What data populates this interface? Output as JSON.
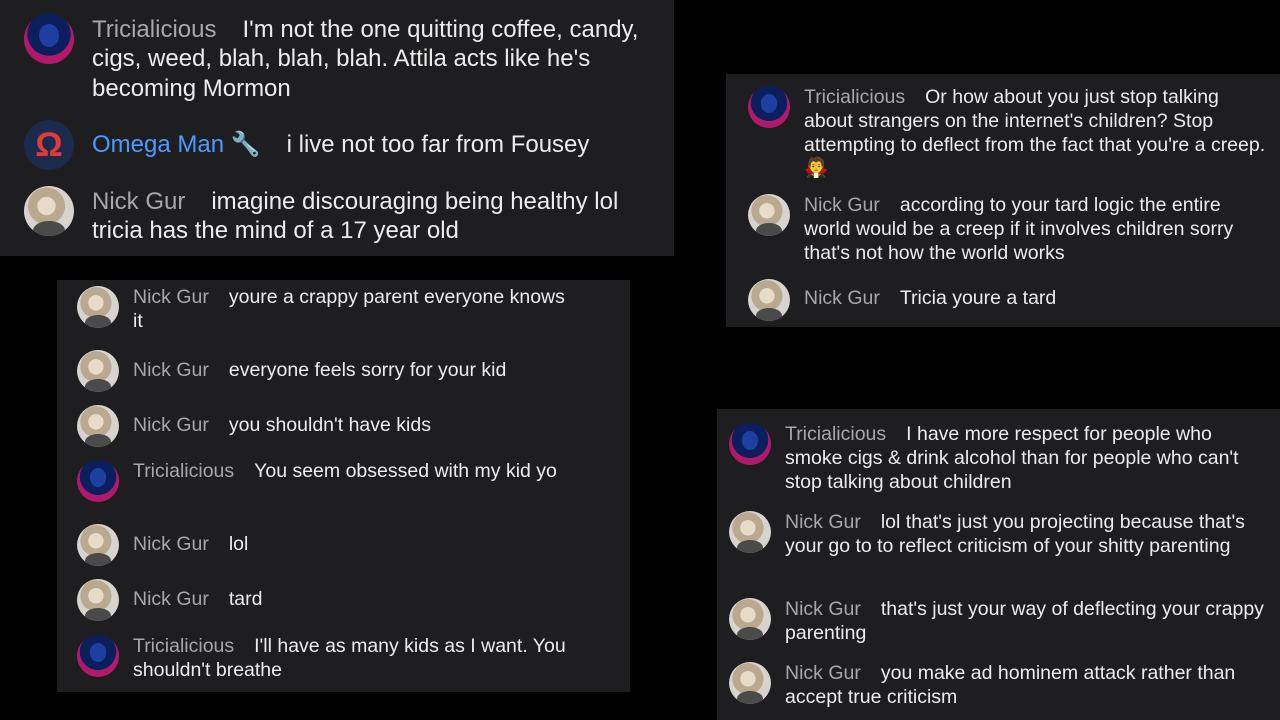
{
  "panel_a": [
    {
      "avatar": "tricia",
      "name": "Tricialicious",
      "text": "I'm not the one quitting coffee, candy, cigs, weed, blah, blah, blah. Attila acts like he's becoming Mormon"
    },
    {
      "avatar": "omega",
      "avatar_glyph": "Ω",
      "name": "Omega Man 🔧",
      "text": "i live not too far from Fousey"
    },
    {
      "avatar": "nick",
      "name": "Nick Gur",
      "text": "imagine discouraging being healthy lol tricia has the mind of a 17 year old"
    }
  ],
  "panel_b": [
    {
      "avatar": "nick",
      "name": "Nick Gur",
      "text": "youre a crappy parent everyone knows it"
    },
    {
      "avatar": "nick",
      "name": "Nick Gur",
      "text": "everyone feels sorry for your kid"
    },
    {
      "avatar": "nick",
      "name": "Nick Gur",
      "text": "you shouldn't have kids"
    },
    {
      "avatar": "tricia",
      "name": "Tricialicious",
      "text": "You seem obsessed with my kid yo"
    },
    {
      "avatar": "nick",
      "name": "Nick Gur",
      "text": "lol"
    },
    {
      "avatar": "nick",
      "name": "Nick Gur",
      "text": "tard"
    },
    {
      "avatar": "tricia",
      "name": "Tricialicious",
      "text": "I'll have as many kids as I want. You shouldn't breathe"
    }
  ],
  "panel_c": [
    {
      "avatar": "tricia",
      "name": "Tricialicious",
      "text": "Or how about you just stop talking about strangers on the internet's children? Stop attempting to deflect from the fact that you're a creep.🧛"
    },
    {
      "avatar": "nick",
      "name": "Nick Gur",
      "text": "according to your tard logic the entire world would be a creep if it involves children sorry that's not how the world works"
    },
    {
      "avatar": "nick",
      "name": "Nick Gur",
      "text": "Tricia youre a tard"
    }
  ],
  "panel_d": [
    {
      "avatar": "tricia",
      "name": "Tricialicious",
      "text": "I have more respect for people who smoke cigs & drink alcohol than for people who can't stop talking about children"
    },
    {
      "avatar": "nick",
      "name": "Nick Gur",
      "text": "lol that's just you projecting because that's your go to to reflect criticism of your shitty parenting"
    },
    {
      "avatar": "nick",
      "name": "Nick Gur",
      "text": "that's just your way of deflecting your crappy parenting"
    },
    {
      "avatar": "nick",
      "name": "Nick Gur",
      "text": "you make ad hominem attack rather than accept true criticism"
    }
  ]
}
